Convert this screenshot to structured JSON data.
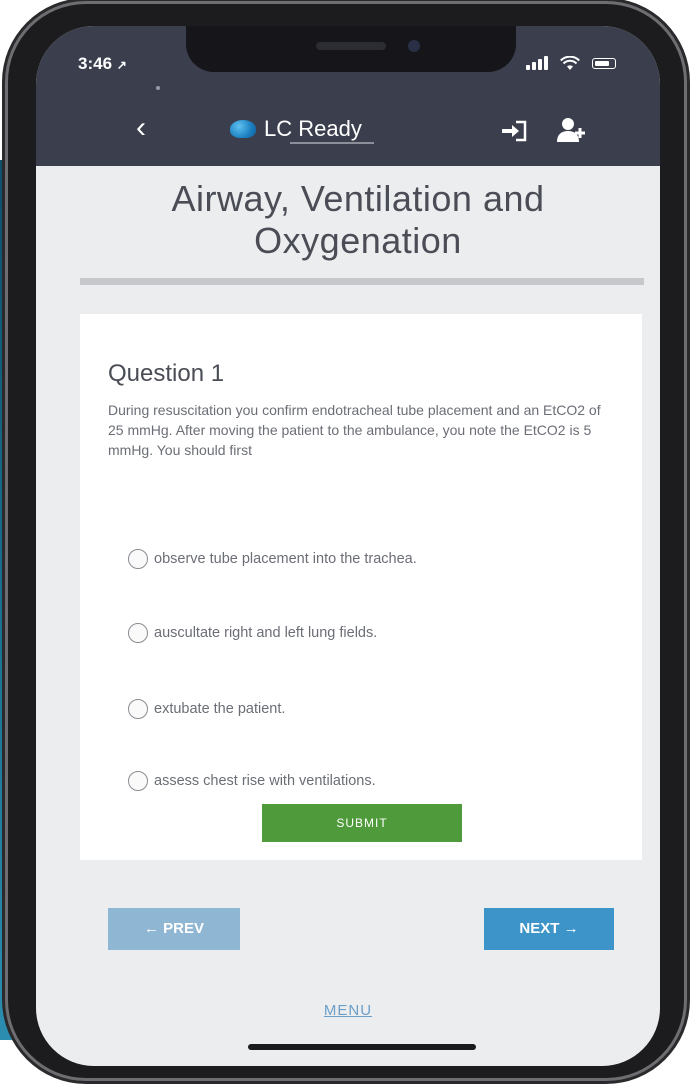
{
  "status_bar": {
    "time": "3:46",
    "location_glyph": "↗"
  },
  "header": {
    "back_glyph": "‹",
    "logo_text": "LC Ready"
  },
  "page": {
    "title": "Airway, Ventilation and Oxygenation"
  },
  "question": {
    "heading": "Question 1",
    "text": "During resuscitation you confirm endotracheal tube placement and an EtCO2 of 25 mmHg. After moving the patient to the ambulance, you note the EtCO2 is 5 mmHg. You should first",
    "options": [
      {
        "label": "observe tube placement into the trachea."
      },
      {
        "label": "auscultate right and left lung fields."
      },
      {
        "label": "extubate the patient."
      },
      {
        "label": "assess chest rise with ventilations."
      }
    ],
    "submit_label": "SUBMIT"
  },
  "navigation": {
    "prev_label": "← PREV",
    "next_label": "NEXT →",
    "menu_label": "MENU"
  },
  "colors": {
    "appbar": "#3b3f4d",
    "submit": "#4f9a3a",
    "prev": "#8fb6d3",
    "next": "#3d94c9",
    "menu_link": "#6b9fc8"
  },
  "icons": {
    "back": "chevron-left-icon",
    "login": "sign-in-icon",
    "user": "user-plus-icon"
  }
}
